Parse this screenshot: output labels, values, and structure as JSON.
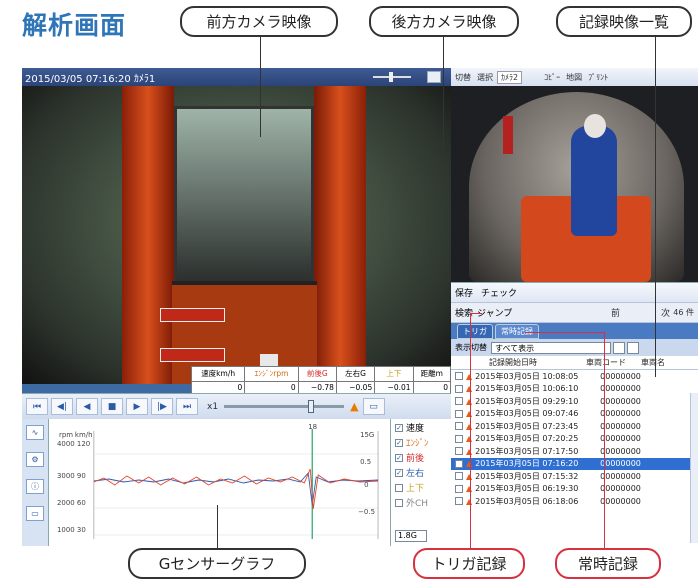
{
  "page_title": "解析画面",
  "callouts": {
    "front_camera": "前方カメラ映像",
    "rear_camera": "後方カメラ映像",
    "record_list": "記録映像一覧",
    "g_sensor": "Gセンサーグラフ",
    "trigger": "トリガ記録",
    "regular": "常時記録"
  },
  "front_view": {
    "title": "2015/03/05 07:16:20 ｶﾒﾗ1"
  },
  "data_table": {
    "headers": [
      "速度km/h",
      "ｴﾝｼﾞﾝrpm",
      "前後G",
      "左右G",
      "上下",
      "距離m"
    ],
    "values": [
      "0",
      "0",
      "−0.78",
      "−0.05",
      "−0.01",
      "0"
    ]
  },
  "controls": {
    "buttons": [
      "⏮",
      "◀|",
      "◀",
      "■",
      "▶",
      "|▶",
      "⏭"
    ],
    "zoom": "x1"
  },
  "graph": {
    "axis_labels": [
      "rpm",
      "km/h",
      "4000",
      "120",
      "3000",
      "90",
      "2000",
      "60",
      "1000",
      "30"
    ],
    "right_ticks": [
      "15G",
      "0.5",
      "0",
      "−0.5"
    ],
    "marker": "18",
    "legend": [
      "速度",
      "ｴﾝｼﾞﾝ",
      "前後",
      "左右",
      "上下",
      "外CH"
    ],
    "select": "1.8G"
  },
  "rear_view": {
    "toolbar": [
      "切替",
      "選択",
      "ｶﾒﾗ2",
      "ｺﾋﾟｰ",
      "地図",
      "ﾌﾟﾘﾝﾄ"
    ]
  },
  "list": {
    "toolbar": [
      "保存",
      "チェック"
    ],
    "search": [
      "検索",
      "ジャンプ"
    ],
    "nav": "前",
    "next": "次",
    "count": "46 件",
    "tabs": [
      "トリガ",
      "常時記録"
    ],
    "filter_label": "表示切替",
    "filter_value": "すべて表示",
    "columns": [
      "記録開始日時",
      "車両コード",
      "車両名"
    ],
    "rows": [
      {
        "date": "2015年03月05日 10:08:05",
        "code": "00000000"
      },
      {
        "date": "2015年03月05日 10:06:10",
        "code": "00000000"
      },
      {
        "date": "2015年03月05日 09:29:10",
        "code": "00000000"
      },
      {
        "date": "2015年03月05日 09:07:46",
        "code": "00000000"
      },
      {
        "date": "2015年03月05日 07:23:45",
        "code": "00000000"
      },
      {
        "date": "2015年03月05日 07:20:25",
        "code": "00000000"
      },
      {
        "date": "2015年03月05日 07:17:50",
        "code": "00000000"
      },
      {
        "date": "2015年03月05日 07:16:20",
        "code": "00000000"
      },
      {
        "date": "2015年03月05日 07:15:32",
        "code": "00000000"
      },
      {
        "date": "2015年03月05日 06:19:30",
        "code": "00000000"
      },
      {
        "date": "2015年03月05日 06:18:06",
        "code": "00000000"
      }
    ]
  }
}
